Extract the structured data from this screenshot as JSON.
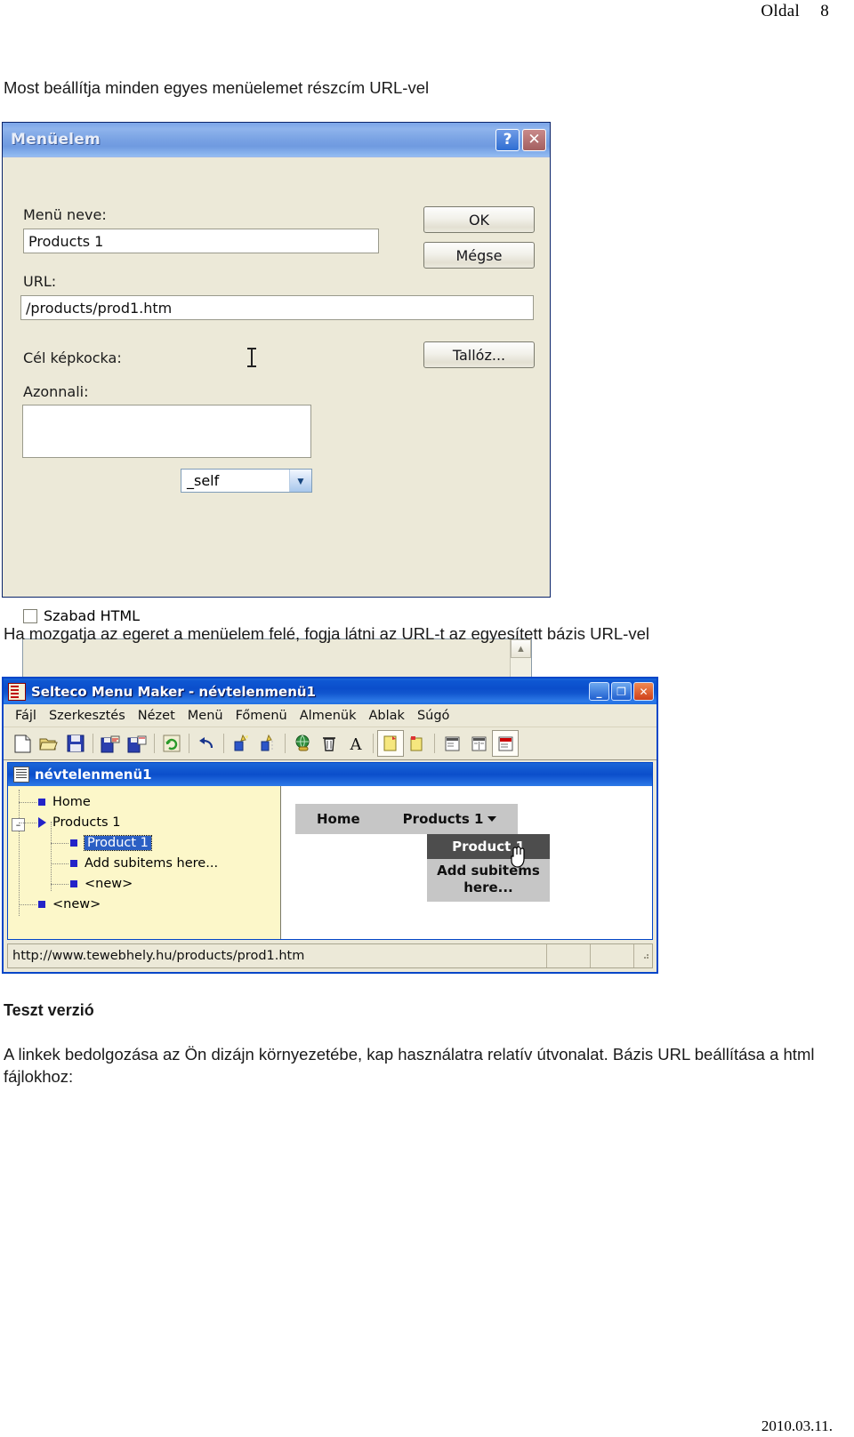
{
  "page": {
    "header_label": "Oldal",
    "page_number": "8",
    "footer_date": "2010.03.11."
  },
  "paragraphs": {
    "intro": "Most beállítja minden egyes menüelemet részcím URL-vel",
    "hover": "Ha mozgatja az egeret a menüelem felé, fogja látni az URL-t az egyesített bázis URL-vel",
    "teszt_heading": "Teszt verzió",
    "closing": "A linkek bedolgozása az Ön dizájn környezetébe, kap használatra relatív útvonalat. Bázis URL beállítása a html fájlokhoz:"
  },
  "dialog": {
    "title": "Menüelem",
    "help_button": "?",
    "close_button": "✕",
    "menu_name_label": "Menü neve:",
    "menu_name_value": "Products 1",
    "url_label": "URL:",
    "url_value": "/products/prod1.htm",
    "target_label": "Cél képkocka:",
    "target_value": "_self",
    "target_options": [
      "_self"
    ],
    "tooltip_label": "Azonnali:",
    "tooltip_value": "",
    "free_html_label": "Szabad HTML",
    "free_html_checked": false,
    "free_html_value": "",
    "ok_label": "OK",
    "cancel_label": "Mégse",
    "browse_label": "Tallóz...",
    "scroll_up_glyph": "▲",
    "scroll_down_glyph": "▼",
    "combo_arrow_glyph": "▼"
  },
  "app": {
    "title": "Selteco Menu Maker  -  névtelenmenü1",
    "window_buttons": {
      "minimize": "_",
      "maximize": "❐",
      "close": "✕"
    },
    "menubar": [
      "Fájl",
      "Szerkesztés",
      "Nézet",
      "Menü",
      "Főmenü",
      "Almenük",
      "Ablak",
      "Súgó"
    ],
    "toolbar_icons": [
      "new-document-icon",
      "open-folder-icon",
      "save-disk-icon",
      "import-icon",
      "export-icon",
      "refresh-icon",
      "undo-icon",
      "add-item-icon",
      "add-subitem-icon",
      "publish-web-icon",
      "delete-trash-icon",
      "font-icon",
      "main-menu-icon",
      "sub-menu-icon",
      "layout-left-icon",
      "layout-columns-icon",
      "layout-top-icon"
    ],
    "mdi": {
      "title": "névtelenmenü1",
      "tree": [
        {
          "label": "Home",
          "level": 1,
          "marker": "bullet",
          "selected": false,
          "expander": ""
        },
        {
          "label": "Products 1",
          "level": 1,
          "marker": "triangle",
          "selected": false,
          "expander": "–"
        },
        {
          "label": "Product 1",
          "level": 2,
          "marker": "bullet",
          "selected": true,
          "expander": ""
        },
        {
          "label": "Add subitems here...",
          "level": 2,
          "marker": "bullet",
          "selected": false,
          "expander": ""
        },
        {
          "label": "<new>",
          "level": 2,
          "marker": "bullet",
          "selected": false,
          "expander": ""
        },
        {
          "label": "<new>",
          "level": 1,
          "marker": "bullet",
          "selected": false,
          "expander": ""
        }
      ],
      "preview": {
        "top_items": [
          "Home",
          "Products 1"
        ],
        "dropdown_parent": "Products 1",
        "dropdown_items": [
          "Product 1",
          "Add subitems here..."
        ],
        "hovered_item": "Product 1"
      }
    },
    "statusbar": {
      "url": "http://www.tewebhely.hu/products/prod1.htm"
    }
  }
}
